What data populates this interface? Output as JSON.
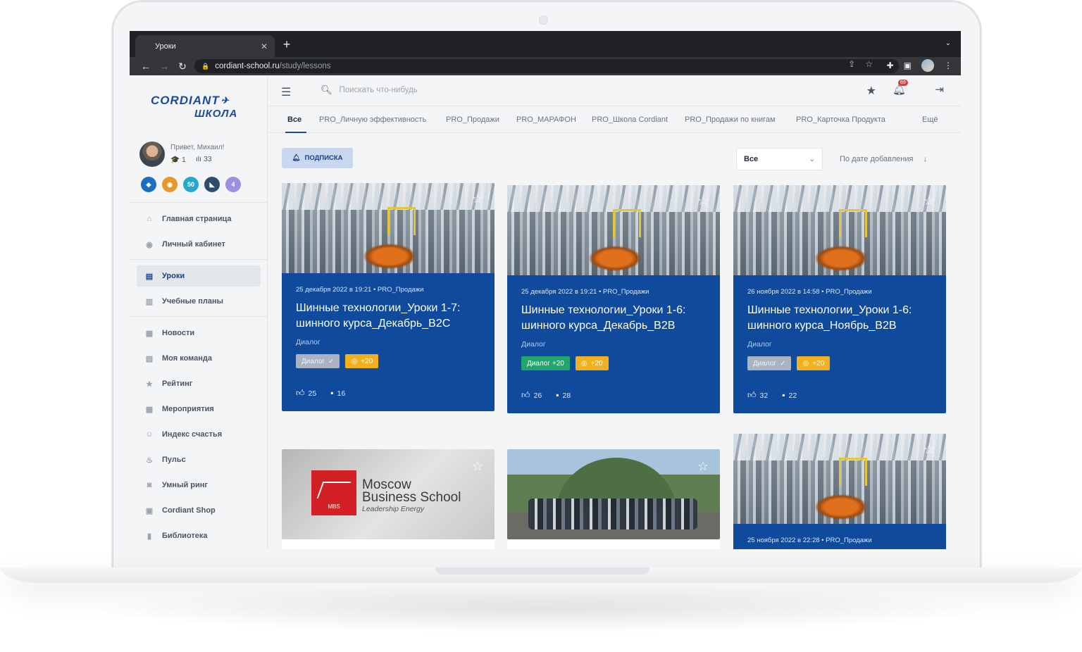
{
  "browser": {
    "tab_title": "Уроки",
    "url_host": "cordiant-school.ru",
    "url_path": "/study/lessons"
  },
  "logo": {
    "line1": "CORDIANT",
    "line2": "ШКОЛА"
  },
  "user": {
    "greeting": "Привет, Михаил!",
    "courses": "1",
    "rating": "33"
  },
  "badges": [
    {
      "name": "badge-cube-icon",
      "label": "",
      "color": "#1b6fc2"
    },
    {
      "name": "badge-globe-icon",
      "label": "",
      "color": "#e39a2a"
    },
    {
      "name": "badge-50-icon",
      "label": "50",
      "color": "#27a7c9"
    },
    {
      "name": "badge-sail-icon",
      "label": "",
      "color": "#2f4b6e"
    },
    {
      "name": "badge-4-icon",
      "label": "4",
      "color": "#9b8fe0"
    }
  ],
  "menu": {
    "home": "Главная страница",
    "cabinet": "Личный кабинет",
    "lessons": "Уроки",
    "plans": "Учебные планы",
    "news": "Новости",
    "team": "Моя команда",
    "rating": "Рейтинг",
    "events": "Мероприятия",
    "happiness": "Индекс счастья",
    "pulse": "Пульс",
    "ring": "Умный ринг",
    "shop": "Cordiant Shop",
    "library": "Библиотека"
  },
  "search": {
    "placeholder": "Поискать что-нибудь"
  },
  "notifications": {
    "count": "69"
  },
  "categories": {
    "all": "Все",
    "c1": "PRO_Личную эффективность",
    "c2": "PRO_Продажи",
    "c3": "PRO_МАРАФОН",
    "c4": "PRO_Школа Cordiant",
    "c5": "PRO_Продажи по книгам",
    "c6": "PRO_Карточка Продукта",
    "more": "Ещё"
  },
  "filters": {
    "subscribe": "ПОДПИСКА",
    "select_value": "Все",
    "sort": "По дате добавления"
  },
  "cards": [
    {
      "meta": "25 декабря 2022 в 19:21 • PRO_Продажи",
      "title": "Шинные технологии_Уроки 1-7: шинного курса_Декабрь_B2C",
      "type": "Диалог",
      "tag": "Диалог",
      "coins": "+20",
      "likes": "25",
      "comments": "16"
    },
    {
      "meta": "25 декабря 2022 в 19:21 • PRO_Продажи",
      "title": "Шинные технологии_Уроки 1-6: шинного курса_Декабрь_B2B",
      "type": "Диалог",
      "tag": "Диалог +20",
      "coins": "+20",
      "likes": "26",
      "comments": "28"
    },
    {
      "meta": "26 ноября 2022 в 14:58 • PRO_Продажи",
      "title": "Шинные технологии_Уроки 1-6: шинного курса_Ноябрь_B2B",
      "type": "Диалог",
      "tag": "Диалог",
      "coins": "+20",
      "likes": "32",
      "comments": "22"
    },
    {
      "meta": "25 ноября 2022 в 22:28 • PRO_Продажи"
    }
  ],
  "mbs": {
    "logo_text": "MBS",
    "line1": "Moscow",
    "line2": "Business School",
    "line3": "Leadership Energy"
  }
}
